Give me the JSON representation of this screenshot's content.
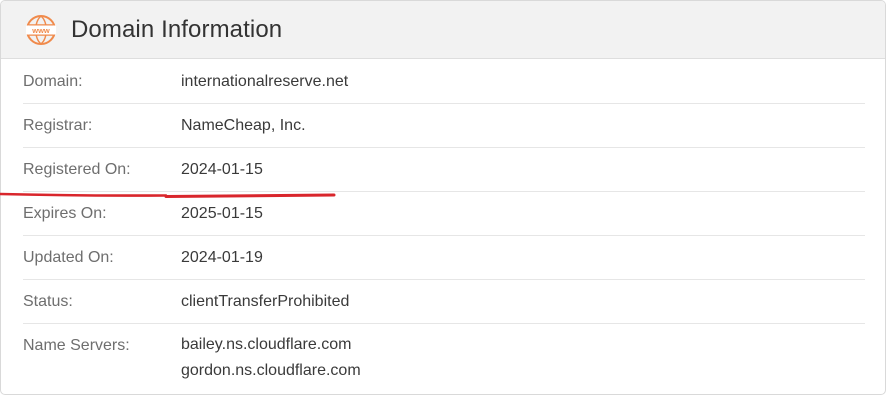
{
  "header": {
    "icon": "www-globe-icon",
    "icon_text": "www",
    "icon_color": "#f08a4b",
    "title": "Domain Information"
  },
  "rows": [
    {
      "label": "Domain:",
      "value": "internationalreserve.net"
    },
    {
      "label": "Registrar:",
      "value": "NameCheap, Inc."
    },
    {
      "label": "Registered On:",
      "value": "2024-01-15"
    },
    {
      "label": "Expires On:",
      "value": "2025-01-15"
    },
    {
      "label": "Updated On:",
      "value": "2024-01-19"
    },
    {
      "label": "Status:",
      "value": "clientTransferProhibited"
    }
  ],
  "name_servers": {
    "label": "Name Servers:",
    "values": [
      "bailey.ns.cloudflare.com",
      "gordon.ns.cloudflare.com"
    ]
  },
  "annotation": {
    "highlighted_row": "Registered On:",
    "color": "#d9262c"
  }
}
